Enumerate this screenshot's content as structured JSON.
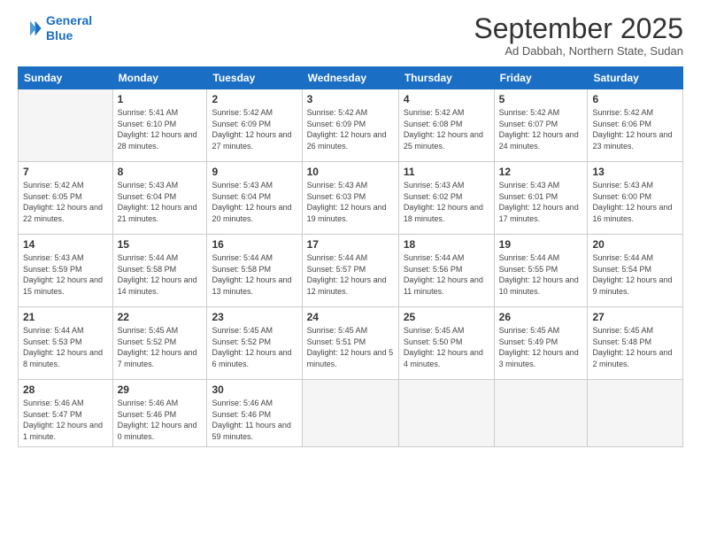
{
  "logo": {
    "line1": "General",
    "line2": "Blue"
  },
  "title": "September 2025",
  "subtitle": "Ad Dabbah, Northern State, Sudan",
  "weekdays": [
    "Sunday",
    "Monday",
    "Tuesday",
    "Wednesday",
    "Thursday",
    "Friday",
    "Saturday"
  ],
  "weeks": [
    [
      {
        "num": "",
        "empty": true
      },
      {
        "num": "1",
        "sunrise": "5:41 AM",
        "sunset": "6:10 PM",
        "daylight": "12 hours and 28 minutes."
      },
      {
        "num": "2",
        "sunrise": "5:42 AM",
        "sunset": "6:09 PM",
        "daylight": "12 hours and 27 minutes."
      },
      {
        "num": "3",
        "sunrise": "5:42 AM",
        "sunset": "6:09 PM",
        "daylight": "12 hours and 26 minutes."
      },
      {
        "num": "4",
        "sunrise": "5:42 AM",
        "sunset": "6:08 PM",
        "daylight": "12 hours and 25 minutes."
      },
      {
        "num": "5",
        "sunrise": "5:42 AM",
        "sunset": "6:07 PM",
        "daylight": "12 hours and 24 minutes."
      },
      {
        "num": "6",
        "sunrise": "5:42 AM",
        "sunset": "6:06 PM",
        "daylight": "12 hours and 23 minutes."
      }
    ],
    [
      {
        "num": "7",
        "sunrise": "5:42 AM",
        "sunset": "6:05 PM",
        "daylight": "12 hours and 22 minutes."
      },
      {
        "num": "8",
        "sunrise": "5:43 AM",
        "sunset": "6:04 PM",
        "daylight": "12 hours and 21 minutes."
      },
      {
        "num": "9",
        "sunrise": "5:43 AM",
        "sunset": "6:04 PM",
        "daylight": "12 hours and 20 minutes."
      },
      {
        "num": "10",
        "sunrise": "5:43 AM",
        "sunset": "6:03 PM",
        "daylight": "12 hours and 19 minutes."
      },
      {
        "num": "11",
        "sunrise": "5:43 AM",
        "sunset": "6:02 PM",
        "daylight": "12 hours and 18 minutes."
      },
      {
        "num": "12",
        "sunrise": "5:43 AM",
        "sunset": "6:01 PM",
        "daylight": "12 hours and 17 minutes."
      },
      {
        "num": "13",
        "sunrise": "5:43 AM",
        "sunset": "6:00 PM",
        "daylight": "12 hours and 16 minutes."
      }
    ],
    [
      {
        "num": "14",
        "sunrise": "5:43 AM",
        "sunset": "5:59 PM",
        "daylight": "12 hours and 15 minutes."
      },
      {
        "num": "15",
        "sunrise": "5:44 AM",
        "sunset": "5:58 PM",
        "daylight": "12 hours and 14 minutes."
      },
      {
        "num": "16",
        "sunrise": "5:44 AM",
        "sunset": "5:58 PM",
        "daylight": "12 hours and 13 minutes."
      },
      {
        "num": "17",
        "sunrise": "5:44 AM",
        "sunset": "5:57 PM",
        "daylight": "12 hours and 12 minutes."
      },
      {
        "num": "18",
        "sunrise": "5:44 AM",
        "sunset": "5:56 PM",
        "daylight": "12 hours and 11 minutes."
      },
      {
        "num": "19",
        "sunrise": "5:44 AM",
        "sunset": "5:55 PM",
        "daylight": "12 hours and 10 minutes."
      },
      {
        "num": "20",
        "sunrise": "5:44 AM",
        "sunset": "5:54 PM",
        "daylight": "12 hours and 9 minutes."
      }
    ],
    [
      {
        "num": "21",
        "sunrise": "5:44 AM",
        "sunset": "5:53 PM",
        "daylight": "12 hours and 8 minutes."
      },
      {
        "num": "22",
        "sunrise": "5:45 AM",
        "sunset": "5:52 PM",
        "daylight": "12 hours and 7 minutes."
      },
      {
        "num": "23",
        "sunrise": "5:45 AM",
        "sunset": "5:52 PM",
        "daylight": "12 hours and 6 minutes."
      },
      {
        "num": "24",
        "sunrise": "5:45 AM",
        "sunset": "5:51 PM",
        "daylight": "12 hours and 5 minutes."
      },
      {
        "num": "25",
        "sunrise": "5:45 AM",
        "sunset": "5:50 PM",
        "daylight": "12 hours and 4 minutes."
      },
      {
        "num": "26",
        "sunrise": "5:45 AM",
        "sunset": "5:49 PM",
        "daylight": "12 hours and 3 minutes."
      },
      {
        "num": "27",
        "sunrise": "5:45 AM",
        "sunset": "5:48 PM",
        "daylight": "12 hours and 2 minutes."
      }
    ],
    [
      {
        "num": "28",
        "sunrise": "5:46 AM",
        "sunset": "5:47 PM",
        "daylight": "12 hours and 1 minute."
      },
      {
        "num": "29",
        "sunrise": "5:46 AM",
        "sunset": "5:46 PM",
        "daylight": "12 hours and 0 minutes."
      },
      {
        "num": "30",
        "sunrise": "5:46 AM",
        "sunset": "5:46 PM",
        "daylight": "11 hours and 59 minutes."
      },
      {
        "num": "",
        "empty": true
      },
      {
        "num": "",
        "empty": true
      },
      {
        "num": "",
        "empty": true
      },
      {
        "num": "",
        "empty": true
      }
    ]
  ]
}
